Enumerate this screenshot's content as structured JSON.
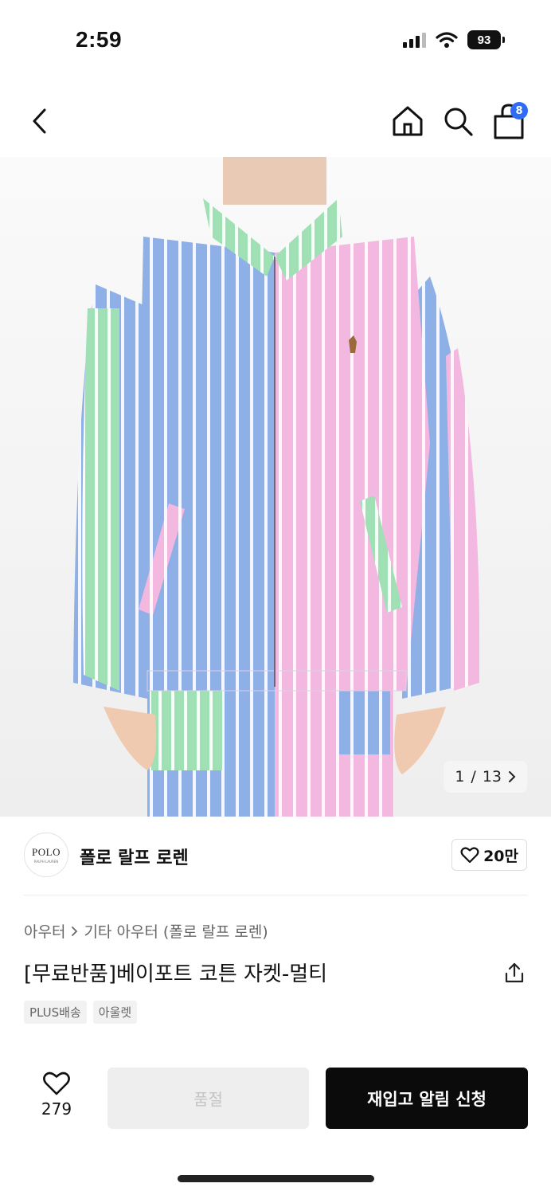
{
  "status_bar": {
    "time": "2:59",
    "battery": "93",
    "icons": [
      "signal-icon",
      "wifi-icon",
      "battery-icon"
    ]
  },
  "nav": {
    "icons": [
      "back-icon",
      "home-icon",
      "search-icon",
      "cart-icon"
    ],
    "cart_badge": "8"
  },
  "image": {
    "counter_current": "1",
    "counter_sep": "/",
    "counter_total": "13",
    "icon": "chevron-right-icon"
  },
  "brand": {
    "logo_text": "POLO",
    "logo_subtext": "RALPH LAUREN",
    "name": "폴로 랄프 로렌",
    "like_count": "20만",
    "like_icon": "heart-outline-icon"
  },
  "breadcrumb": {
    "items": [
      "아우터",
      "기타 아우터 (폴로 랄프 로렌)"
    ],
    "separator_icon": "chevron-right-icon"
  },
  "product": {
    "title": "[무료반품]베이포트 코튼 자켓-멀티",
    "tags": [
      "PLUS배송",
      "아울렛"
    ],
    "share_icon": "share-icon"
  },
  "bottom": {
    "wish_count": "279",
    "soldout_label": "품절",
    "restock_label": "재입고 알림 신청"
  },
  "colors": {
    "accent_badge": "#2f6cf6",
    "primary_button": "#0b0b0b",
    "disabled_button": "#eeeeee",
    "stripe_blue": "#8fb0e6",
    "stripe_pink": "#f3b8e0",
    "stripe_green": "#9fe0b4"
  }
}
